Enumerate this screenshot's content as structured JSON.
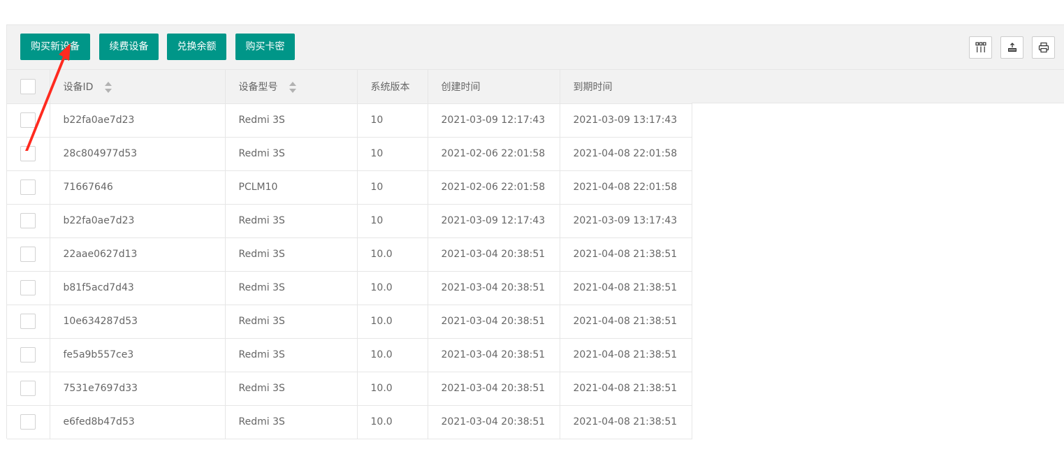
{
  "toolbar": {
    "buttons": [
      {
        "label": "购买新设备"
      },
      {
        "label": "续费设备"
      },
      {
        "label": "兑换余额"
      },
      {
        "label": "购买卡密"
      }
    ],
    "tools": [
      {
        "icon": "columns-icon"
      },
      {
        "icon": "export-icon"
      },
      {
        "icon": "print-icon"
      }
    ]
  },
  "table": {
    "headers": [
      "设备ID",
      "设备型号",
      "系统版本",
      "创建时间",
      "到期时间"
    ],
    "rows": [
      [
        "b22fa0ae7d23",
        "Redmi 3S",
        "10",
        "2021-03-09 12:17:43",
        "2021-03-09 13:17:43"
      ],
      [
        "28c804977d53",
        "Redmi 3S",
        "10",
        "2021-02-06 22:01:58",
        "2021-04-08 22:01:58"
      ],
      [
        "71667646",
        "PCLM10",
        "10",
        "2021-02-06 22:01:58",
        "2021-04-08 22:01:58"
      ],
      [
        "b22fa0ae7d23",
        "Redmi 3S",
        "10",
        "2021-03-09 12:17:43",
        "2021-03-09 13:17:43"
      ],
      [
        "22aae0627d13",
        "Redmi 3S",
        "10.0",
        "2021-03-04 20:38:51",
        "2021-04-08 21:38:51"
      ],
      [
        "b81f5acd7d43",
        "Redmi 3S",
        "10.0",
        "2021-03-04 20:38:51",
        "2021-04-08 21:38:51"
      ],
      [
        "10e634287d53",
        "Redmi 3S",
        "10.0",
        "2021-03-04 20:38:51",
        "2021-04-08 21:38:51"
      ],
      [
        "fe5a9b557ce3",
        "Redmi 3S",
        "10.0",
        "2021-03-04 20:38:51",
        "2021-04-08 21:38:51"
      ],
      [
        "7531e7697d33",
        "Redmi 3S",
        "10.0",
        "2021-03-04 20:38:51",
        "2021-04-08 21:38:51"
      ],
      [
        "e6fed8b47d53",
        "Redmi 3S",
        "10.0",
        "2021-03-04 20:38:51",
        "2021-04-08 21:38:51"
      ]
    ]
  },
  "colors": {
    "primary": "#009688",
    "header_bg": "#f2f2f2",
    "border": "#e6e6e6",
    "annotation_arrow": "#ff2a1f"
  }
}
